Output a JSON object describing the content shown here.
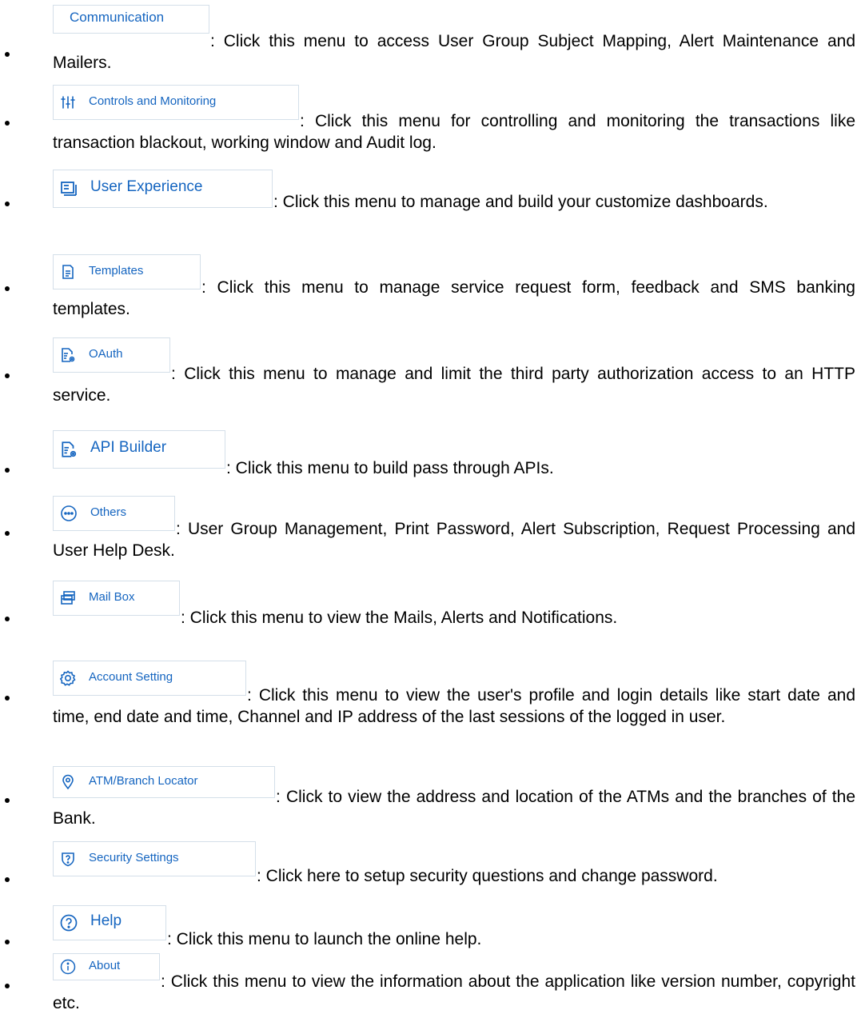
{
  "items": [
    {
      "label": "Communication",
      "icon": "none",
      "text": ": Click this menu to access User Group Subject Mapping, Alert Maintenance and Mailers."
    },
    {
      "label": "Controls and Monitoring",
      "icon": "sliders-icon",
      "text": ": Click this menu for controlling and monitoring the transactions like transaction blackout, working window and Audit log."
    },
    {
      "label": "User Experience",
      "icon": "dashboard-icon",
      "text": ":  Click this menu to manage and build your customize dashboards."
    },
    {
      "label": "Templates",
      "icon": "document-icon",
      "text": ": Click this menu to manage service request form, feedback and SMS banking templates."
    },
    {
      "label": "OAuth",
      "icon": "document-gear-icon",
      "text": ": Click this menu to manage and limit the third party authorization access to an HTTP service."
    },
    {
      "label": "API Builder",
      "icon": "document-gear-icon",
      "text": ": Click this menu to build pass through APIs."
    },
    {
      "label": "Others",
      "icon": "more-icon",
      "text": ": User Group Management, Print Password, Alert Subscription, Request Processing and User Help Desk."
    },
    {
      "label": "Mail Box",
      "icon": "mailbox-icon",
      "text": ": Click this menu to view the Mails, Alerts and Notifications."
    },
    {
      "label": "Account Setting",
      "icon": "gear-icon",
      "text": ": Click this menu to view the user's profile and  login details like start date and time, end date and time, Channel and IP address of the last sessions of the  logged in user."
    },
    {
      "label": "ATM/Branch Locator",
      "icon": "location-pin-icon",
      "text": ": Click to view the address and location of the ATMs and the branches of the Bank."
    },
    {
      "label": "Security Settings",
      "icon": "shield-question-icon",
      "text": ": Click here to setup security questions and change password."
    },
    {
      "label": "Help",
      "icon": "help-icon",
      "text": ": Click this menu to launch the online help."
    },
    {
      "label": "About",
      "icon": "info-icon",
      "text": ": Click this menu to view the information about the application like version number, copyright etc."
    }
  ]
}
